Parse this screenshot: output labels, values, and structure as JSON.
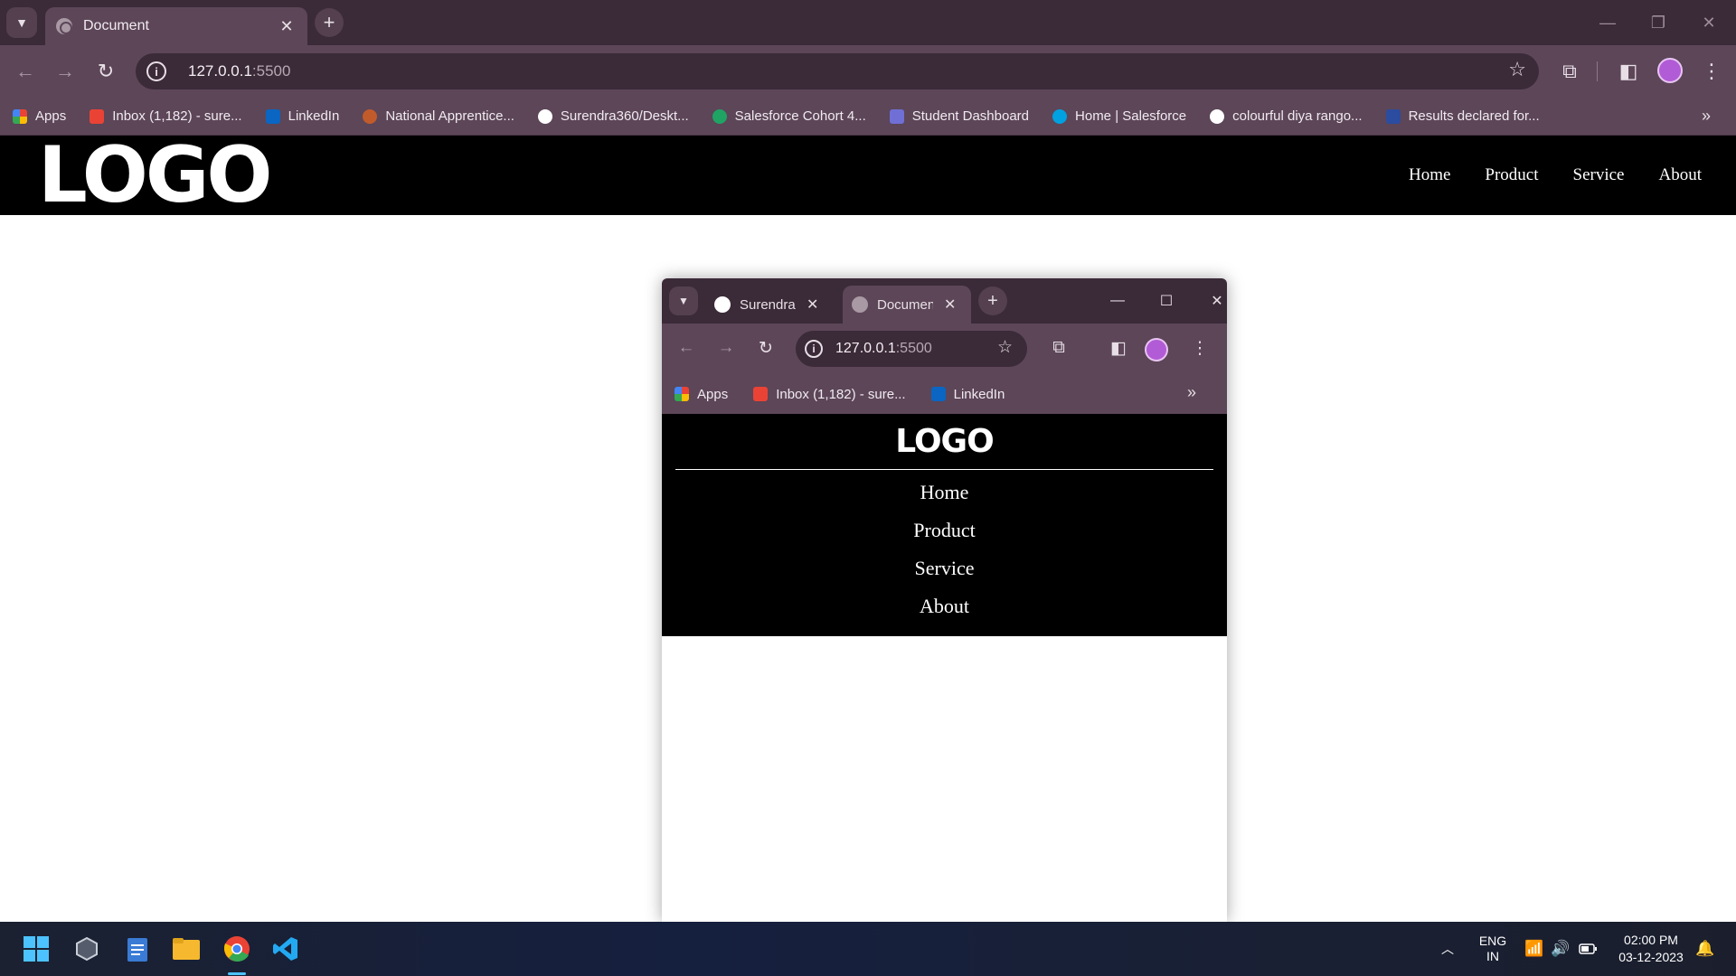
{
  "browser": {
    "tab_title": "Document",
    "url_host": "127.0.0.1",
    "url_port": ":5500",
    "bookmarks": [
      {
        "label": "Apps",
        "color": "#4285f4"
      },
      {
        "label": "Inbox (1,182) - sure...",
        "color": "#ea4335"
      },
      {
        "label": "LinkedIn",
        "color": "#0a66c2"
      },
      {
        "label": "National Apprentice...",
        "color": "#c25b2b"
      },
      {
        "label": "Surendra360/Deskt...",
        "color": "#ffffff"
      },
      {
        "label": "Salesforce Cohort 4...",
        "color": "#1fa463"
      },
      {
        "label": "Student Dashboard",
        "color": "#6f6fd6"
      },
      {
        "label": "Home | Salesforce",
        "color": "#00a1e0"
      },
      {
        "label": "colourful diya rango...",
        "color": "#ffffff"
      },
      {
        "label": "Results declared for...",
        "color": "#2b4c9f"
      }
    ],
    "overflow_label": "»"
  },
  "site": {
    "logo": "LOGO",
    "nav": [
      "Home",
      "Product",
      "Service",
      "About"
    ]
  },
  "inner_window": {
    "tabs": [
      {
        "title": "Surendra",
        "icon": "github-icon"
      },
      {
        "title": "Documen",
        "icon": "globe-icon"
      }
    ],
    "url_host": "127.0.0.1",
    "url_port": ":5500",
    "bookmarks": [
      {
        "label": "Apps",
        "color": "#4285f4"
      },
      {
        "label": "Inbox (1,182) - sure...",
        "color": "#ea4335"
      },
      {
        "label": "LinkedIn",
        "color": "#0a66c2"
      }
    ],
    "overflow_label": "»",
    "site": {
      "logo": "LOGO",
      "nav": [
        "Home",
        "Product",
        "Service",
        "About"
      ]
    }
  },
  "taskbar": {
    "language": "ENG",
    "region": "IN",
    "time": "02:00 PM",
    "date": "03-12-2023"
  },
  "colors": {
    "chrome_dark": "#3b2a38",
    "chrome_toolbar": "#5c4658",
    "site_header": "#000000",
    "avatar": "#b25bd6"
  }
}
